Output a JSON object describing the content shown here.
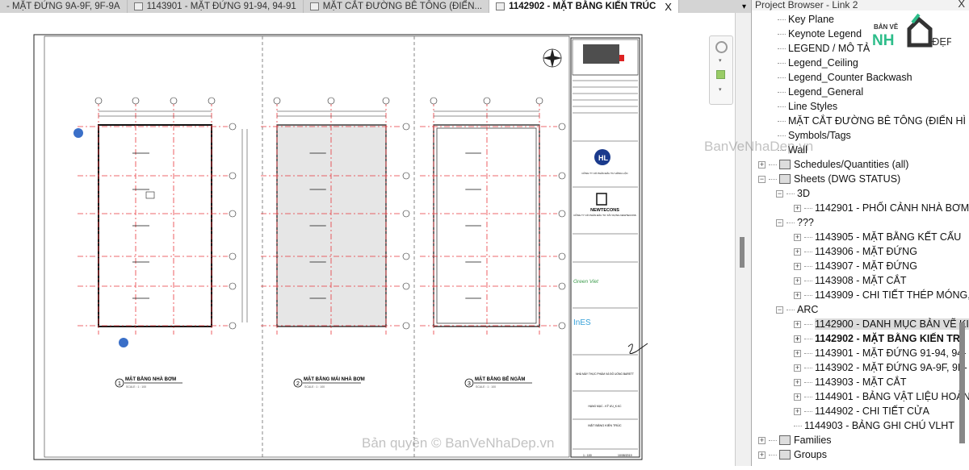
{
  "tabs": [
    {
      "label": "- MẶT ĐỨNG 9A-9F, 9F-9A",
      "active": false
    },
    {
      "label": "1143901 - MẶT ĐỨNG 91-94, 94-91",
      "active": false
    },
    {
      "label": "MẶT CẮT ĐƯỜNG BÊ TÔNG (ĐIỂN...",
      "active": false
    },
    {
      "label": "1142902 - MẶT BẰNG KIẾN TRÚC",
      "active": true
    }
  ],
  "close_label": "X",
  "tab_menu_icon": "▾",
  "sheet": {
    "views": [
      {
        "number": "1",
        "title": "MẶT BẰNG NHÀ BƠM",
        "scale": "SCALE : 1 : 100"
      },
      {
        "number": "2",
        "title": "MẶT BẰNG MÁI NHÀ BƠM",
        "scale": "SCALE : 1 : 100"
      },
      {
        "number": "3",
        "title": "MẶT BẰNG BỂ NGẦM",
        "scale": "SCALE : 1 : 100"
      }
    ],
    "titleblock": {
      "company1": "CÔNG TY CỔ PHẦN ĐẦU TƯ HỒNG LỘC",
      "logo1": "HL",
      "logo2": "NEWTECONS",
      "company2": "CÔNG TY CỔ PHẦN ĐẦU TƯ XÂY DỰNG NEWTECONS",
      "logo3": "Green Viet",
      "logo4": "InES",
      "project": "NHÀ MÁY THỰC PHẨM VÀ ĐỒ UỐNG BARETT",
      "item": "HẠNG MỤC - KỸ ƯU_K.KC",
      "drawing_title": "MẶT BẰNG KIẾN TRÚC",
      "scale": "1 : 100",
      "date": "10/08/2019"
    }
  },
  "project_browser": {
    "title": "Project Browser - Link 2",
    "logo_text": {
      "top": "BẢN VẼ",
      "mid": "NH",
      "right": "ĐẸP"
    },
    "items": [
      {
        "label": "Key Plane",
        "level": 3,
        "toggle": ""
      },
      {
        "label": "Keynote Legend",
        "level": 3,
        "toggle": ""
      },
      {
        "label": "LEGEND / MÔ TẢ",
        "level": 3,
        "toggle": ""
      },
      {
        "label": "Legend_Ceiling",
        "level": 3,
        "toggle": ""
      },
      {
        "label": "Legend_Counter Backwash",
        "level": 3,
        "toggle": ""
      },
      {
        "label": "Legend_General",
        "level": 3,
        "toggle": ""
      },
      {
        "label": "Line Styles",
        "level": 3,
        "toggle": ""
      },
      {
        "label": "MẶT CẮT ĐƯỜNG BÊ TÔNG (ĐIỂN HÌ",
        "level": 3,
        "toggle": ""
      },
      {
        "label": "Symbols/Tags",
        "level": 3,
        "toggle": ""
      },
      {
        "label": "Wall",
        "level": 3,
        "toggle": ""
      },
      {
        "label": "Schedules/Quantities (all)",
        "level": 0,
        "toggle": "+",
        "icon": "schedule-icon"
      },
      {
        "label": "Sheets (DWG STATUS)",
        "level": 0,
        "toggle": "−",
        "icon": "sheets-icon"
      },
      {
        "label": "3D",
        "level": 1,
        "toggle": "−"
      },
      {
        "label": "1142901 - PHỐI CẢNH NHÀ BƠM",
        "level": 2,
        "toggle": "+"
      },
      {
        "label": "???",
        "level": 1,
        "toggle": "−"
      },
      {
        "label": "1143905 - MẶT BẰNG KẾT CẤU",
        "level": 2,
        "toggle": "+"
      },
      {
        "label": "1143906 - MẶT ĐỨNG",
        "level": 2,
        "toggle": "+"
      },
      {
        "label": "1143907 - MẶT ĐỨNG",
        "level": 2,
        "toggle": "+"
      },
      {
        "label": "1143908 - MẶT CẮT",
        "level": 2,
        "toggle": "+"
      },
      {
        "label": "1143909 - CHI TIẾT THÉP MÓNG,I",
        "level": 2,
        "toggle": "+"
      },
      {
        "label": "ARC",
        "level": 1,
        "toggle": "−"
      },
      {
        "label": "1142900 - DANH MỤC BẢN VẼ KI",
        "level": 2,
        "toggle": "+",
        "selected": true
      },
      {
        "label": "1142902 - MẶT BẰNG KIẾN TR",
        "level": 2,
        "toggle": "+",
        "bold": true
      },
      {
        "label": "1143901 - MẶT ĐỨNG 91-94, 94-",
        "level": 2,
        "toggle": "+"
      },
      {
        "label": "1143902 - MẶT ĐỨNG 9A-9F, 9F-",
        "level": 2,
        "toggle": "+"
      },
      {
        "label": "1143903 - MẶT CẮT",
        "level": 2,
        "toggle": "+"
      },
      {
        "label": "1144901 - BẢNG VẬT LIỆU HOÀN",
        "level": 2,
        "toggle": "+"
      },
      {
        "label": "1144902 - CHI TIẾT CỬA",
        "level": 2,
        "toggle": "+"
      },
      {
        "label": "1144903 - BẢNG GHI CHÚ VLHT",
        "level": 2,
        "toggle": ""
      },
      {
        "label": "Families",
        "level": 0,
        "toggle": "+",
        "icon": "families-icon"
      },
      {
        "label": "Groups",
        "level": 0,
        "toggle": "+",
        "icon": "groups-icon"
      }
    ]
  },
  "watermarks": {
    "side": "BanVeNhaDep.vn",
    "bottom": "Bản quyền © BanVeNhaDep.vn"
  },
  "colors": {
    "grid": "#e8383d",
    "accent_green": "#2dbd8a",
    "tab_bar": "#d4d4d4"
  }
}
